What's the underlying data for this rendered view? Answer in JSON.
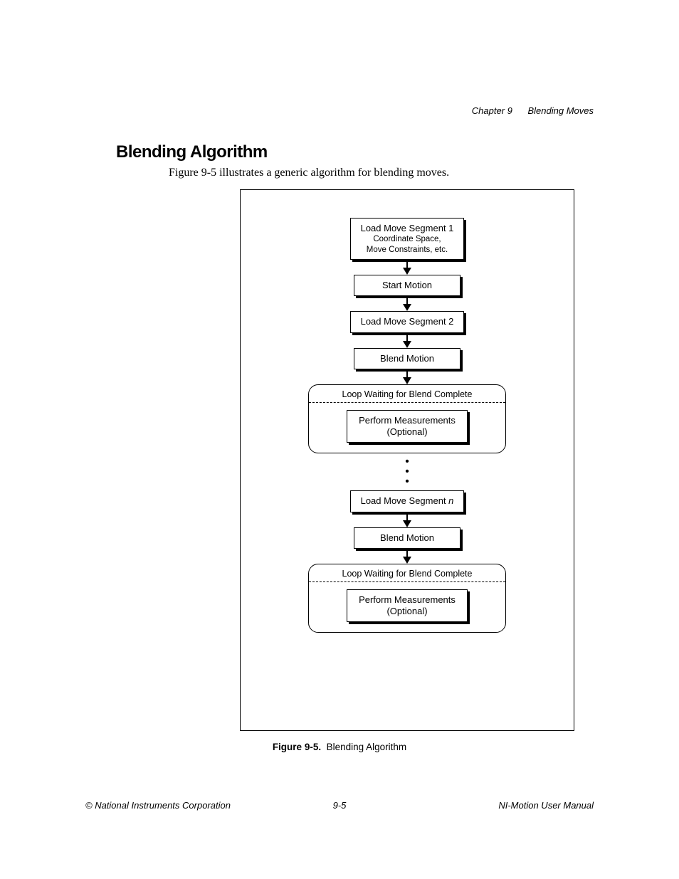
{
  "header": {
    "chapter": "Chapter 9",
    "title": "Blending Moves"
  },
  "section": {
    "heading": "Blending Algorithm",
    "intro": "Figure 9-5 illustrates a generic algorithm for blending moves."
  },
  "flow": {
    "box1_line1": "Load Move Segment 1",
    "box1_line2": "Coordinate Space,",
    "box1_line3": "Move Constraints, etc.",
    "box2": "Start Motion",
    "box3": "Load Move Segment 2",
    "box4": "Blend Motion",
    "loop1_title": "Loop Waiting for Blend Complete",
    "loop1_body_l1": "Perform Measurements",
    "loop1_body_l2": "(Optional)",
    "boxN_prefix": "Load Move Segment ",
    "boxN_var": "n",
    "box6": "Blend Motion",
    "loop2_title": "Loop Waiting for Blend Complete",
    "loop2_body_l1": "Perform Measurements",
    "loop2_body_l2": "(Optional)"
  },
  "caption": {
    "label": "Figure 9-5.",
    "text": "Blending Algorithm"
  },
  "footer": {
    "left": "© National Instruments Corporation",
    "center": "9-5",
    "right": "NI-Motion User Manual"
  }
}
